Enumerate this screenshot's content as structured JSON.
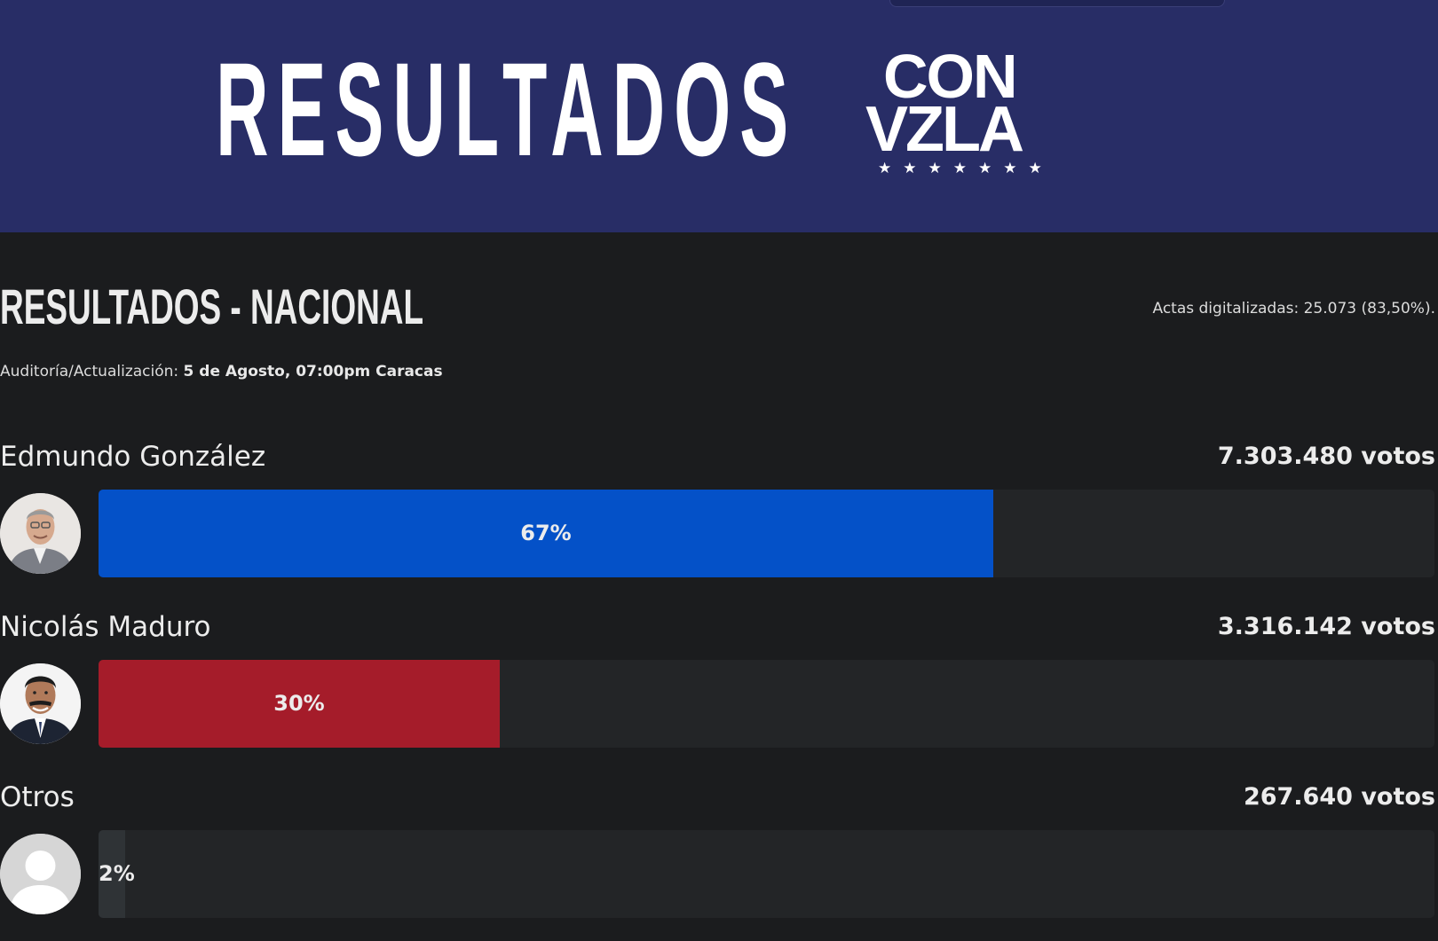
{
  "banner": {
    "title": "RESULTADOS",
    "logo_line1": "CON",
    "logo_line2": "VZLA",
    "logo_stars": "★★★★★★★",
    "background_color": "#282d66"
  },
  "section": {
    "title": "RESULTADOS - NACIONAL",
    "actas": "Actas digitalizadas: 25.073 (83,50%).",
    "audit_label": "Auditoría/Actualización: ",
    "audit_value": "5 de Agosto, 07:00pm Caracas"
  },
  "candidates": [
    {
      "name": "Edmundo González",
      "votes": "7.303.480 votos",
      "percent_label": "67%",
      "fill_fraction": 0.67,
      "color": "#0451c8",
      "avatar": "candidate-photo"
    },
    {
      "name": "Nicolás Maduro",
      "votes": "3.316.142 votos",
      "percent_label": "30%",
      "fill_fraction": 0.3,
      "color": "#a51c2a",
      "avatar": "candidate-photo"
    },
    {
      "name": "Otros",
      "votes": "267.640 votos",
      "percent_label": "2%",
      "fill_fraction": 0.02,
      "color": "#2f3336",
      "avatar": "default-user-icon"
    }
  ],
  "colors": {
    "page_background": "#1b1c1e",
    "track_background": "#232527"
  }
}
